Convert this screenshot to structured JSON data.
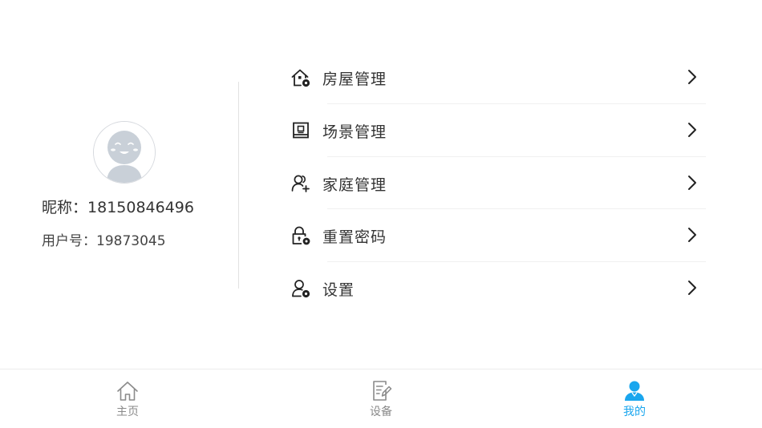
{
  "profile": {
    "nickname_label": "昵称：",
    "nickname_value": "18150846496",
    "userid_label": "用户号：",
    "userid_value": "19873045"
  },
  "menu": {
    "items": [
      {
        "label": "房屋管理",
        "icon": "house-gear-icon"
      },
      {
        "label": "场景管理",
        "icon": "scene-frame-icon"
      },
      {
        "label": "家庭管理",
        "icon": "family-add-icon"
      },
      {
        "label": "重置密码",
        "icon": "lock-gear-icon"
      },
      {
        "label": "设置",
        "icon": "user-gear-icon"
      }
    ]
  },
  "tabbar": {
    "tabs": [
      {
        "label": "主页",
        "icon": "home-icon",
        "active": false
      },
      {
        "label": "设备",
        "icon": "device-edit-icon",
        "active": false
      },
      {
        "label": "我的",
        "icon": "person-icon",
        "active": true
      }
    ]
  },
  "colors": {
    "accent": "#1aa6ee",
    "text": "#333333",
    "inactive": "#8a8a8a",
    "divider": "#e2e2e2"
  }
}
